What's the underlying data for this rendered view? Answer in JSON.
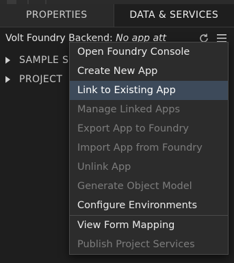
{
  "tabs": {
    "properties": "PROPERTIES",
    "data_services": "DATA & SERVICES"
  },
  "backend": {
    "label": "Volt Foundry Backend:",
    "value": "No app att"
  },
  "tree": {
    "items": [
      {
        "label": "SAMPLE S"
      },
      {
        "label": "PROJECT"
      }
    ]
  },
  "menu": {
    "items": [
      {
        "label": "Open Foundry Console",
        "state": "enabled"
      },
      {
        "label": "Create New App",
        "state": "enabled"
      },
      {
        "label": "Link to Existing App",
        "state": "highlighted"
      },
      {
        "label": "Manage Linked Apps",
        "state": "disabled"
      },
      {
        "label": "Export App to Foundry",
        "state": "disabled"
      },
      {
        "label": "Import App from Foundry",
        "state": "disabled"
      },
      {
        "label": "Unlink App",
        "state": "disabled"
      },
      {
        "label": "Generate Object Model",
        "state": "disabled"
      },
      {
        "label": "Configure Environments",
        "state": "enabled"
      },
      {
        "label": "View Form Mapping",
        "state": "enabled"
      },
      {
        "label": "Publish Project Services",
        "state": "disabled"
      }
    ]
  },
  "icons": {
    "refresh": "refresh-icon",
    "menu": "hamburger-menu-icon",
    "caret": "caret-right-icon"
  },
  "colors": {
    "background": "#1e1e1e",
    "menu_background": "#2c2c2c",
    "highlight": "#3d4a5a",
    "enabled_text": "#ececec",
    "disabled_text": "#7d7d7d"
  }
}
